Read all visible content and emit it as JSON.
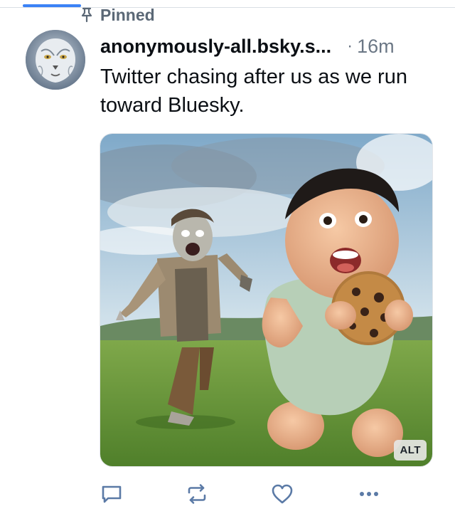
{
  "pinned": {
    "label": "Pinned"
  },
  "post": {
    "handle": "anonymously-all.bsky.s...",
    "separator": "·",
    "time": "16m",
    "text": "Twitter chasing after us as we run toward Bluesky.",
    "image": {
      "alt_badge": "ALT"
    }
  },
  "actions": {
    "icons": [
      "reply-icon",
      "repost-icon",
      "like-icon",
      "more-icon"
    ]
  },
  "colors": {
    "accent": "#3b82f6",
    "muted": "#6b7785",
    "action": "#5b7aa6"
  }
}
